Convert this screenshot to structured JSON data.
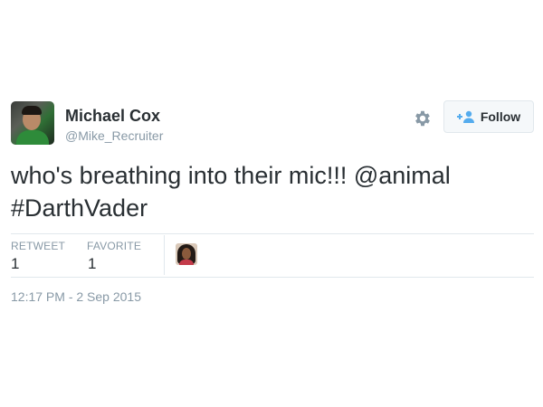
{
  "author": {
    "name": "Michael Cox",
    "handle": "@Mike_Recruiter"
  },
  "actions": {
    "settings_icon": "gear-icon",
    "follow_icon": "follow-user-icon",
    "follow_label": "Follow"
  },
  "tweet": {
    "text_part1": "who's breathing into their mic!!! ",
    "mention": "@animal",
    "hashtag": "#DarthVader"
  },
  "stats": {
    "retweet_label": "RETWEET",
    "retweet_count": "1",
    "favorite_label": "FAVORITE",
    "favorite_count": "1"
  },
  "timestamp": "12:17 PM - 2 Sep 2015",
  "colors": {
    "text": "#292f33",
    "muted": "#8899a6",
    "accent": "#55acee",
    "border": "#e1e8ed"
  }
}
